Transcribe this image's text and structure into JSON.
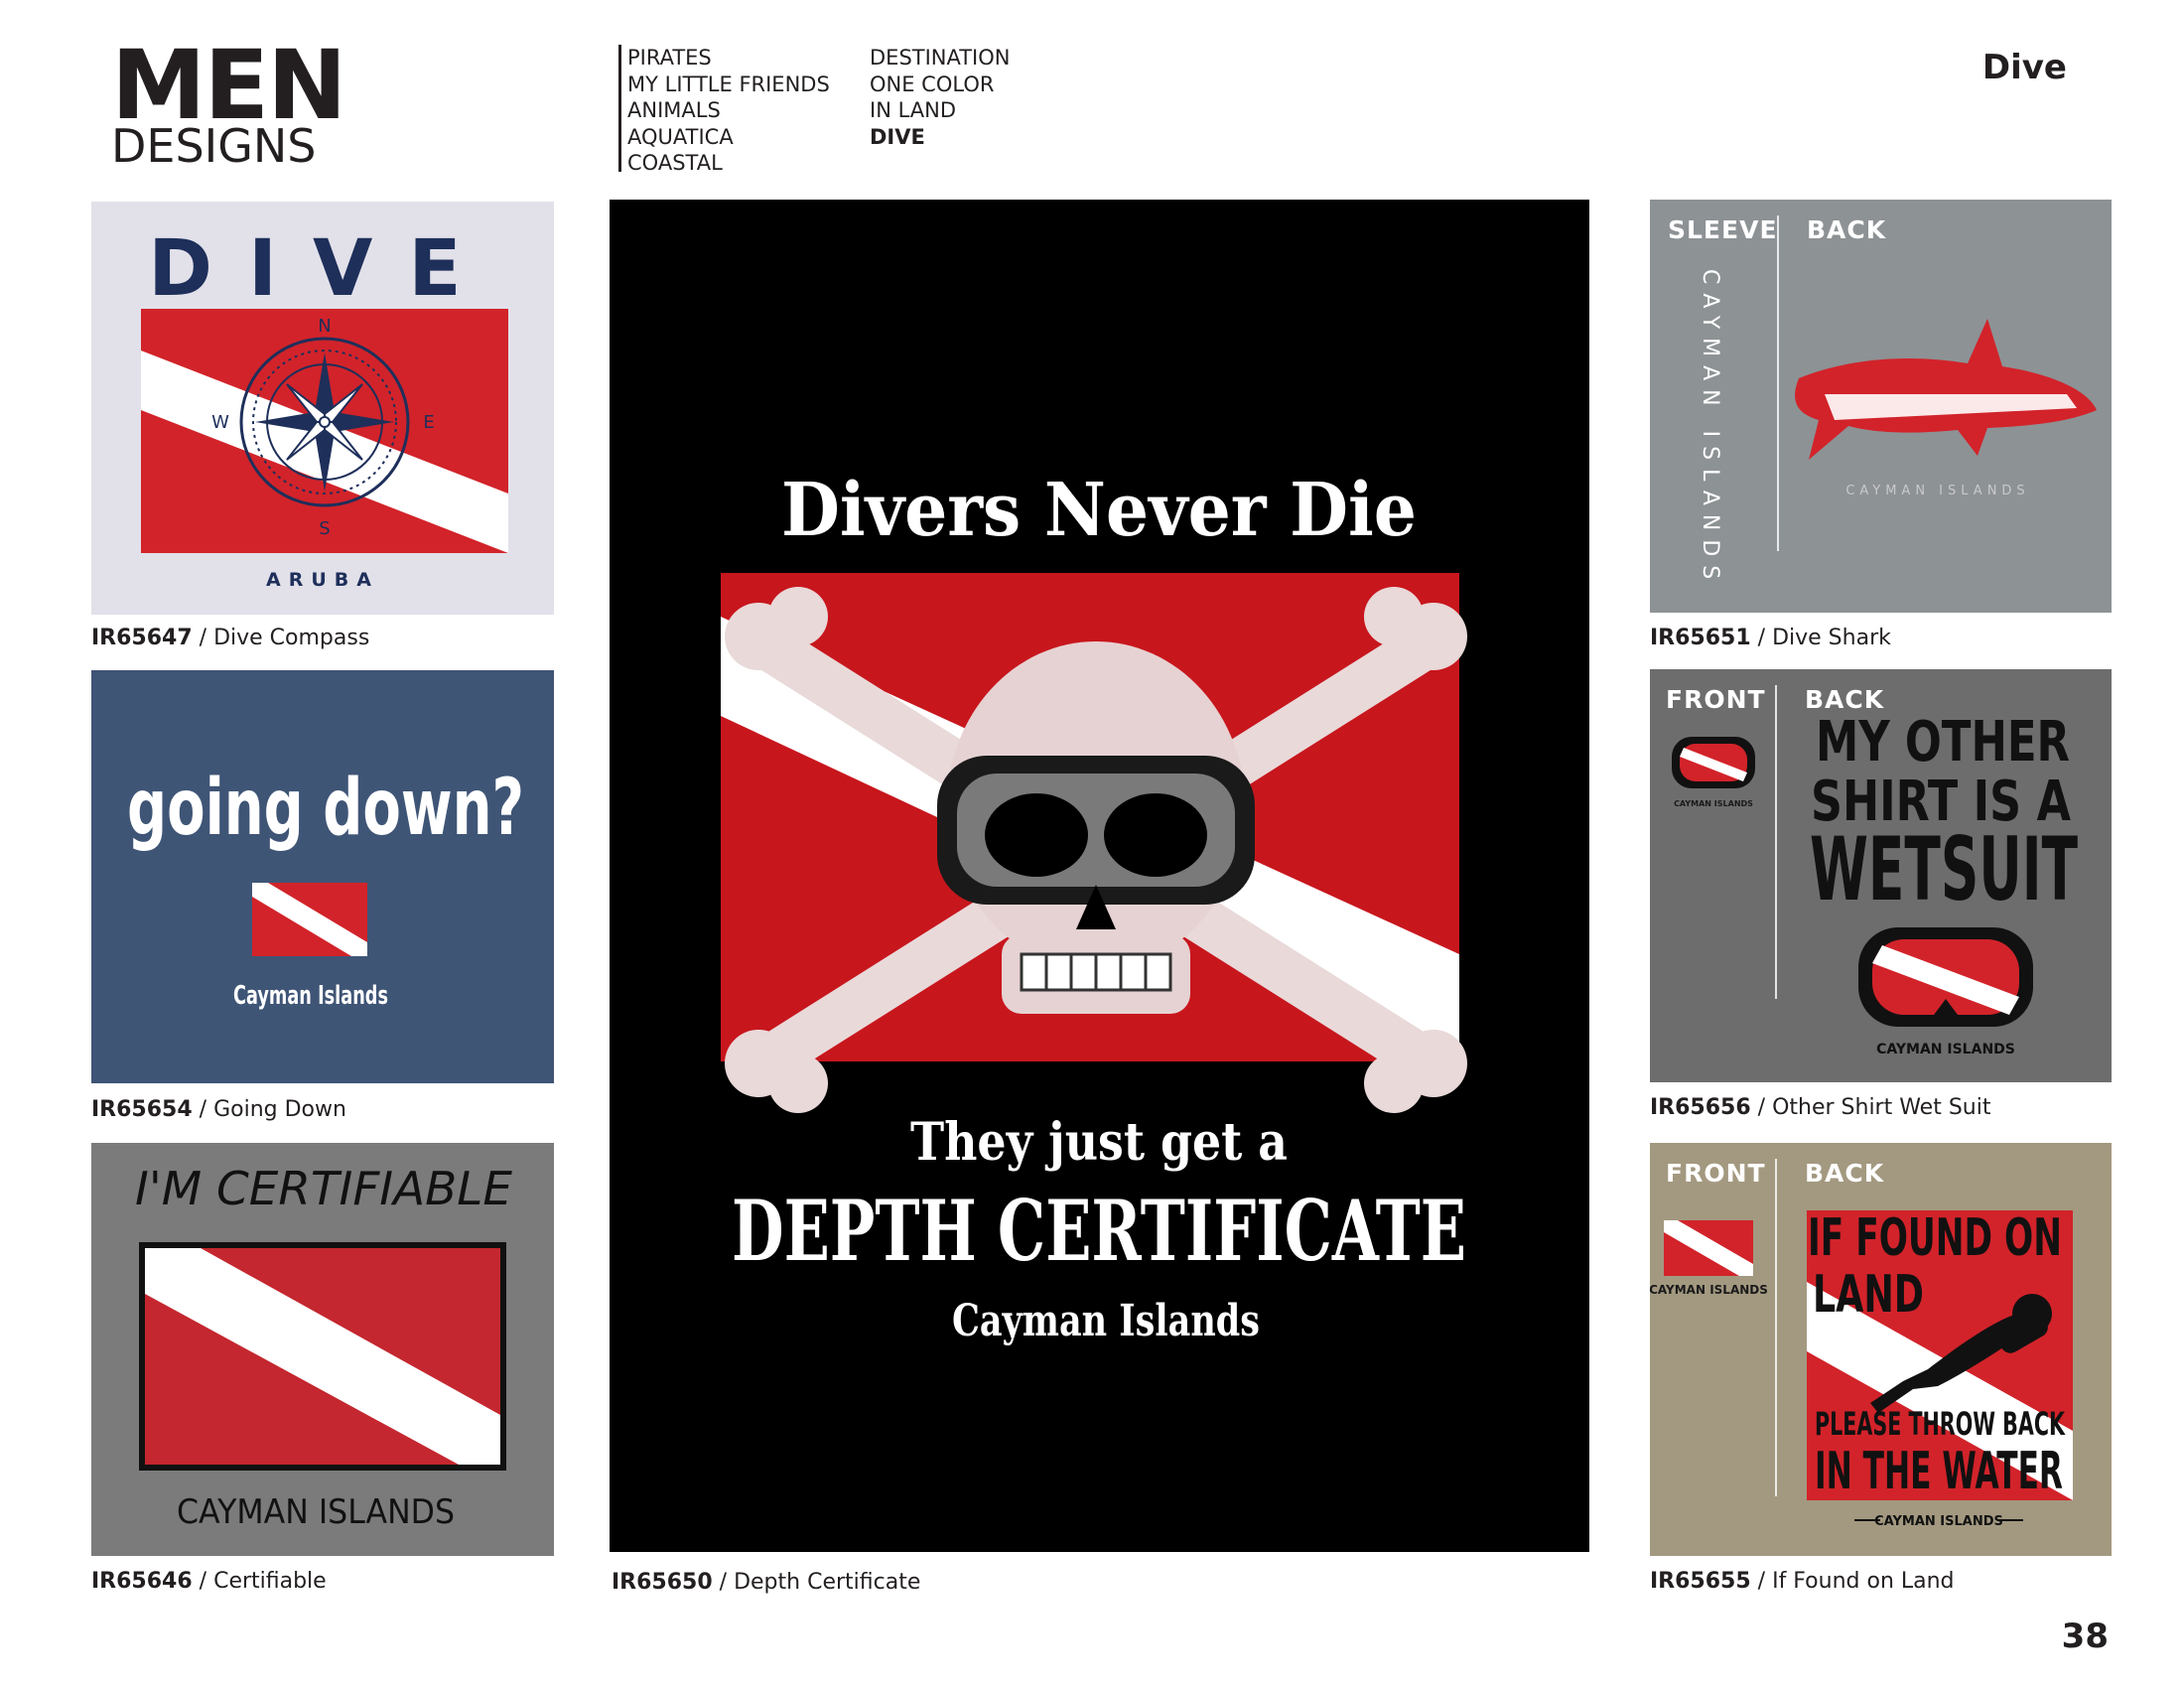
{
  "header": {
    "brand_line1": "MEN",
    "brand_line2": "DESIGNS",
    "section_title": "Dive",
    "nav_col1": [
      "PIRATES",
      "MY LITTLE FRIENDS",
      "ANIMALS",
      "AQUATICA",
      "COASTAL"
    ],
    "nav_col2": [
      "DESTINATION",
      "ONE COLOR",
      "IN LAND",
      "DIVE"
    ],
    "active_category": "DIVE"
  },
  "page_number": "38",
  "colors": {
    "dive_red": "#d2232a",
    "navy": "#1e2f5a",
    "white": "#ffffff"
  },
  "designs": [
    {
      "code": "IR65647",
      "name": "Dive Compass",
      "tile_color": "#e2e1ea",
      "art": {
        "headline": "DIVE",
        "location": "ARUBA",
        "compass": [
          "N",
          "S",
          "E",
          "W"
        ]
      }
    },
    {
      "code": "IR65654",
      "name": "Going Down",
      "tile_color": "#3f5576",
      "art": {
        "headline": "going down?",
        "location": "Cayman Islands"
      }
    },
    {
      "code": "IR65646",
      "name": "Certifiable",
      "tile_color": "#7b7b7b",
      "art": {
        "headline": "I'M CERTIFIABLE",
        "location": "CAYMAN ISLANDS"
      }
    },
    {
      "code": "IR65650",
      "name": "Depth Certificate",
      "tile_color": "#000000",
      "art": {
        "line1": "Divers Never Die",
        "line2": "They just get a",
        "line3": "DEPTH CERTIFICATE",
        "location": "Cayman Islands"
      }
    },
    {
      "code": "IR65651",
      "name": "Dive Shark",
      "tile_color": "#8d9295",
      "art": {
        "left_label": "SLEEVE",
        "right_label": "BACK",
        "sleeve_text": "CAYMAN ISLANDS",
        "back_text": "CAYMAN ISLANDS"
      }
    },
    {
      "code": "IR65656",
      "name": "Other Shirt Wet Suit",
      "tile_color": "#6d6d6d",
      "art": {
        "left_label": "FRONT",
        "right_label": "BACK",
        "front_text": "CAYMAN ISLANDS",
        "line1": "MY OTHER",
        "line2": "SHIRT IS A",
        "line3": "WETSUIT",
        "location": "CAYMAN ISLANDS"
      }
    },
    {
      "code": "IR65655",
      "name": "If Found on Land",
      "tile_color": "#a39980",
      "art": {
        "left_label": "FRONT",
        "right_label": "BACK",
        "front_text": "CAYMAN ISLANDS",
        "line1": "IF FOUND ON",
        "line2": "LAND",
        "line3": "PLEASE THROW BACK",
        "line4": "IN THE WATER",
        "location": "CAYMAN ISLANDS"
      }
    }
  ]
}
